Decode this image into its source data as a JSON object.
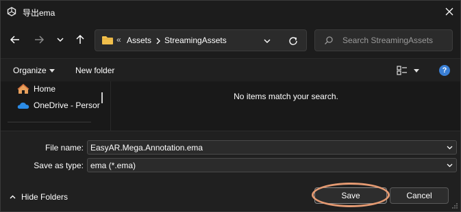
{
  "window": {
    "title": "导出ema"
  },
  "nav": {
    "address": {
      "overflow": "«",
      "crumbs": [
        "Assets",
        "StreamingAssets"
      ]
    },
    "search": {
      "placeholder": "Search StreamingAssets"
    }
  },
  "toolbar": {
    "organize_label": "Organize",
    "new_folder_label": "New folder",
    "help_label": "?"
  },
  "sidebar": {
    "items": [
      {
        "label": "Home",
        "icon": "home-icon"
      },
      {
        "label": "OneDrive - Persor",
        "icon": "cloud-icon"
      }
    ]
  },
  "content": {
    "empty_message": "No items match your search."
  },
  "form": {
    "file_name_label": "File name:",
    "file_name_value": "EasyAR.Mega.Annotation.ema",
    "save_as_type_label": "Save as type:",
    "save_as_type_value": "ema (*.ema)",
    "hide_folders_label": "Hide Folders",
    "save_label": "Save",
    "cancel_label": "Cancel"
  },
  "colors": {
    "accent": "#3a7fd5",
    "highlight": "#e49a72",
    "folder": "#f2c04c",
    "cloud": "#2b8be6"
  }
}
